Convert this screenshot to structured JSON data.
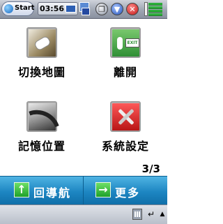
{
  "statusbar": {
    "start_label": "Start",
    "time": "03:56",
    "icons": [
      "network-icon",
      "windows-icon",
      "scroll-down-icon",
      "close-icon",
      "signal-icon"
    ]
  },
  "menu": {
    "items": [
      {
        "label": "切換地圖",
        "icon": "map-switch-icon"
      },
      {
        "label": "離開",
        "icon": "exit-icon"
      },
      {
        "label": "記憶位置",
        "icon": "memory-location-icon"
      },
      {
        "label": "系統設定",
        "icon": "system-settings-icon"
      }
    ],
    "page_indicator": "3/3"
  },
  "navbar": {
    "back_label": "回導航",
    "more_label": "更多",
    "back_icon": "arrow-up-icon",
    "more_icon": "arrow-right-icon",
    "colors": {
      "bar": "#1d86c2",
      "arrow": "#2bb236"
    }
  },
  "sysbar": {
    "icons": [
      "keyboard-icon",
      "return-icon",
      "up-arrow-icon"
    ]
  }
}
